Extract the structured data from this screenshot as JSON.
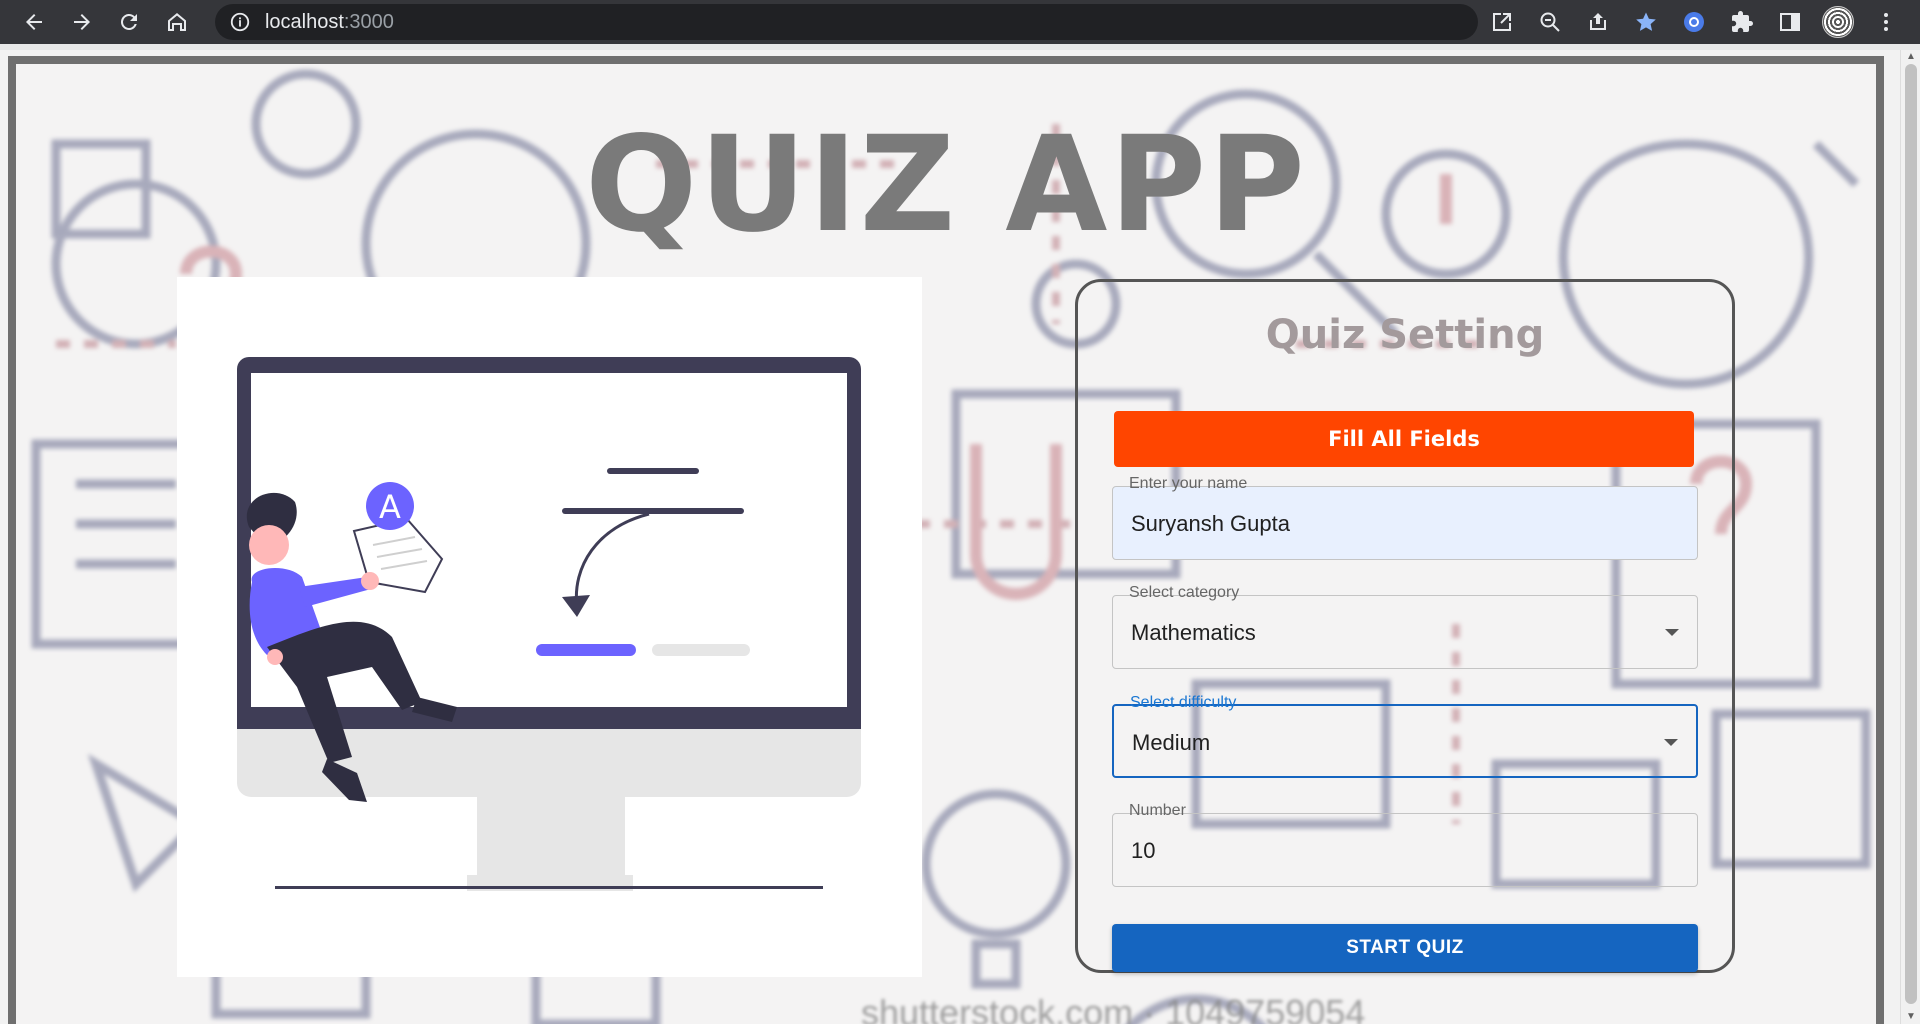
{
  "browser": {
    "url_host": "localhost",
    "url_port": ":3000"
  },
  "page": {
    "title": "QUIZ APP",
    "watermark": "shutterstock.com · 1049759054"
  },
  "illustration": {
    "badge_letter": "A"
  },
  "settings": {
    "title": "Quiz Setting",
    "alert": "Fill All Fields",
    "name_field": {
      "label": "Enter your name",
      "value": "Suryansh Gupta"
    },
    "category_field": {
      "label": "Select category",
      "value": "Mathematics"
    },
    "difficulty_field": {
      "label": "Select difficulty",
      "value": "Medium"
    },
    "number_field": {
      "label": "Number",
      "value": "10"
    },
    "start_label": "START QUIZ"
  },
  "colors": {
    "alert": "#ff4500",
    "primary": "#1565c0",
    "title": "#7a7a7a",
    "accent_purple": "#6c63ff"
  }
}
